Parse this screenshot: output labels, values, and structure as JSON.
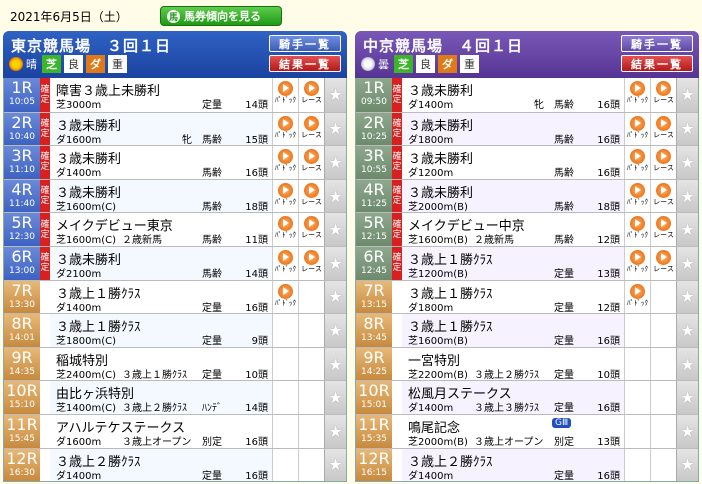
{
  "header": {
    "date": "2021年6月5日（土）",
    "trend_button": "馬券傾向を見る",
    "trend_icon": "馬"
  },
  "panels": [
    {
      "title": "東京競馬場　３回１日",
      "weather_icon": "sun-icon",
      "weather": "晴",
      "turf_label": "芝",
      "turf_cond": "良",
      "dirt_label": "ダ",
      "dirt_cond": "重",
      "jockey_button": "騎手一覧",
      "result_button": "結果一覧",
      "races": [
        {
          "num": "1R",
          "time": "10:05",
          "confirmed": true,
          "name": "障害３歳上未勝利",
          "dist": "芝3000m",
          "class": "",
          "cond": "定量",
          "count": "14頭",
          "paddock": true,
          "race_video": true
        },
        {
          "num": "2R",
          "time": "10:40",
          "confirmed": true,
          "name": "３歳未勝利",
          "dist": "ダ1600m",
          "class": "",
          "cond": "牝　馬齢",
          "count": "15頭",
          "paddock": true,
          "race_video": true
        },
        {
          "num": "3R",
          "time": "11:10",
          "confirmed": true,
          "name": "３歳未勝利",
          "dist": "ダ1400m",
          "class": "",
          "cond": "馬齢",
          "count": "16頭",
          "paddock": true,
          "race_video": true
        },
        {
          "num": "4R",
          "time": "11:40",
          "confirmed": true,
          "name": "３歳未勝利",
          "dist": "芝1600m(C)",
          "class": "",
          "cond": "馬齢",
          "count": "18頭",
          "paddock": true,
          "race_video": true
        },
        {
          "num": "5R",
          "time": "12:30",
          "confirmed": true,
          "name": "メイクデビュー東京",
          "dist": "芝1600m(C)",
          "class": "２歳新馬",
          "cond": "馬齢",
          "count": "11頭",
          "paddock": true,
          "race_video": true
        },
        {
          "num": "6R",
          "time": "13:00",
          "confirmed": true,
          "name": "３歳未勝利",
          "dist": "ダ2100m",
          "class": "",
          "cond": "馬齢",
          "count": "14頭",
          "paddock": true,
          "race_video": true
        },
        {
          "num": "7R",
          "time": "13:30",
          "confirmed": false,
          "name": "３歳上１勝ｸﾗｽ",
          "dist": "ダ1400m",
          "class": "",
          "cond": "定量",
          "count": "16頭",
          "paddock": true,
          "race_video": false
        },
        {
          "num": "8R",
          "time": "14:01",
          "confirmed": false,
          "name": "３歳上１勝ｸﾗｽ",
          "dist": "芝1800m(C)",
          "class": "",
          "cond": "定量",
          "count": "9頭",
          "paddock": false,
          "race_video": false
        },
        {
          "num": "9R",
          "time": "14:35",
          "confirmed": false,
          "name": "稲城特別",
          "dist": "芝2400m(C)",
          "class": "３歳上１勝ｸﾗｽ",
          "cond": "定量",
          "count": "10頭",
          "paddock": false,
          "race_video": false
        },
        {
          "num": "10R",
          "time": "15:10",
          "confirmed": false,
          "name": "由比ヶ浜特別",
          "dist": "芝1400m(C)",
          "class": "３歳上２勝ｸﾗｽ",
          "cond": "ﾊﾝﾃﾞ",
          "count": "14頭",
          "paddock": false,
          "race_video": false
        },
        {
          "num": "11R",
          "time": "15:45",
          "confirmed": false,
          "name": "アハルテケステークス",
          "dist": "ダ1600m",
          "class": "３歳上オープン",
          "cond": "別定",
          "count": "16頭",
          "paddock": false,
          "race_video": false
        },
        {
          "num": "12R",
          "time": "16:30",
          "confirmed": false,
          "name": "３歳上２勝ｸﾗｽ",
          "dist": "ダ1400m",
          "class": "",
          "cond": "定量",
          "count": "16頭",
          "paddock": false,
          "race_video": false
        }
      ]
    },
    {
      "title": "中京競馬場　４回１日",
      "weather_icon": "cloud-icon",
      "weather": "曇",
      "turf_label": "芝",
      "turf_cond": "良",
      "dirt_label": "ダ",
      "dirt_cond": "重",
      "jockey_button": "騎手一覧",
      "result_button": "結果一覧",
      "races": [
        {
          "num": "1R",
          "time": "09:50",
          "confirmed": true,
          "name": "３歳未勝利",
          "dist": "ダ1400m",
          "class": "",
          "cond": "牝　馬齢",
          "count": "16頭",
          "paddock": true,
          "race_video": true
        },
        {
          "num": "2R",
          "time": "10:25",
          "confirmed": true,
          "name": "３歳未勝利",
          "dist": "ダ1800m",
          "class": "",
          "cond": "馬齢",
          "count": "16頭",
          "paddock": true,
          "race_video": true
        },
        {
          "num": "3R",
          "time": "10:55",
          "confirmed": true,
          "name": "３歳未勝利",
          "dist": "ダ1200m",
          "class": "",
          "cond": "馬齢",
          "count": "16頭",
          "paddock": true,
          "race_video": true
        },
        {
          "num": "4R",
          "time": "11:25",
          "confirmed": true,
          "name": "３歳未勝利",
          "dist": "芝2000m(B)",
          "class": "",
          "cond": "馬齢",
          "count": "18頭",
          "paddock": true,
          "race_video": true
        },
        {
          "num": "5R",
          "time": "12:15",
          "confirmed": true,
          "name": "メイクデビュー中京",
          "dist": "芝1600m(B)",
          "class": "２歳新馬",
          "cond": "馬齢",
          "count": "12頭",
          "paddock": true,
          "race_video": true
        },
        {
          "num": "6R",
          "time": "12:45",
          "confirmed": true,
          "name": "３歳上１勝ｸﾗｽ",
          "dist": "芝1200m(B)",
          "class": "",
          "cond": "定量",
          "count": "13頭",
          "paddock": true,
          "race_video": true
        },
        {
          "num": "7R",
          "time": "13:15",
          "confirmed": false,
          "name": "３歳上１勝ｸﾗｽ",
          "dist": "ダ1800m",
          "class": "",
          "cond": "定量",
          "count": "12頭",
          "paddock": true,
          "race_video": false
        },
        {
          "num": "8R",
          "time": "13:45",
          "confirmed": false,
          "name": "３歳上１勝ｸﾗｽ",
          "dist": "芝1600m(B)",
          "class": "",
          "cond": "定量",
          "count": "16頭",
          "paddock": false,
          "race_video": false
        },
        {
          "num": "9R",
          "time": "14:25",
          "confirmed": false,
          "name": "一宮特別",
          "dist": "芝2200m(B)",
          "class": "３歳上２勝ｸﾗｽ",
          "cond": "定量",
          "count": "10頭",
          "paddock": false,
          "race_video": false
        },
        {
          "num": "10R",
          "time": "15:01",
          "confirmed": false,
          "name": "松風月ステークス",
          "dist": "ダ1400m",
          "class": "３歳上３勝ｸﾗｽ",
          "cond": "定量",
          "count": "16頭",
          "paddock": false,
          "race_video": false
        },
        {
          "num": "11R",
          "time": "15:35",
          "confirmed": false,
          "name": "鳴尾記念",
          "dist": "芝2000m(B)",
          "class": "３歳上オープン",
          "cond": "別定",
          "count": "13頭",
          "paddock": false,
          "race_video": false,
          "grade": "GⅢ"
        },
        {
          "num": "12R",
          "time": "16:15",
          "confirmed": false,
          "name": "３歳上２勝ｸﾗｽ",
          "dist": "ダ1400m",
          "class": "",
          "cond": "定量",
          "count": "16頭",
          "paddock": false,
          "race_video": false
        }
      ]
    }
  ],
  "labels": {
    "confirmed_top": "確",
    "confirmed_bottom": "定",
    "paddock": "ﾊﾟﾄﾞｯｸ",
    "race_video": "レース",
    "star": "★"
  },
  "colors": {
    "tokyo": "#1b43a0",
    "chukyo": "#553493",
    "confirmed": "#d82020",
    "trend_button": "#1f9a16"
  }
}
